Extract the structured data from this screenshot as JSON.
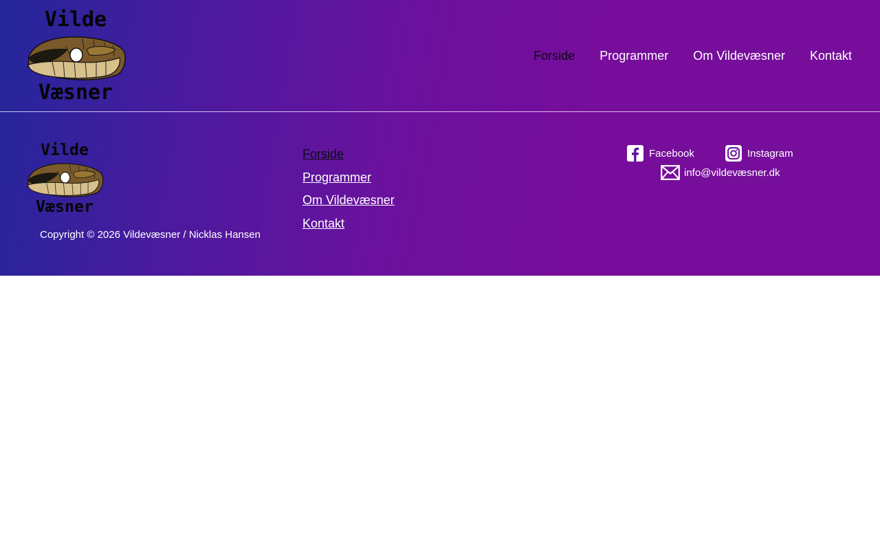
{
  "site": {
    "name": "Vildevæsner",
    "logo_text_top": "Vilde",
    "logo_text_bottom": "Væsner"
  },
  "nav": {
    "items": [
      {
        "label": "Forside",
        "active": true
      },
      {
        "label": "Programmer",
        "active": false
      },
      {
        "label": "Om Vildevæsner",
        "active": false
      },
      {
        "label": "Kontakt",
        "active": false
      }
    ]
  },
  "footer": {
    "copyright": "Copyright © 2026 Vildevæsner / Nicklas Hansen",
    "links": [
      {
        "label": "Forside"
      },
      {
        "label": "Programmer"
      },
      {
        "label": "Om Vildevæsner"
      },
      {
        "label": "Kontakt"
      }
    ],
    "social": {
      "facebook": {
        "label": "Facebook",
        "icon": "facebook-icon"
      },
      "instagram": {
        "label": "Instagram",
        "icon": "instagram-icon"
      },
      "email": {
        "label": "info@vildevæsner.dk",
        "icon": "mail-icon"
      }
    }
  },
  "colors": {
    "gradient_start": "#22279a",
    "gradient_end": "#760d9b",
    "text": "#ffffff",
    "active_link": "#0a0a14"
  }
}
